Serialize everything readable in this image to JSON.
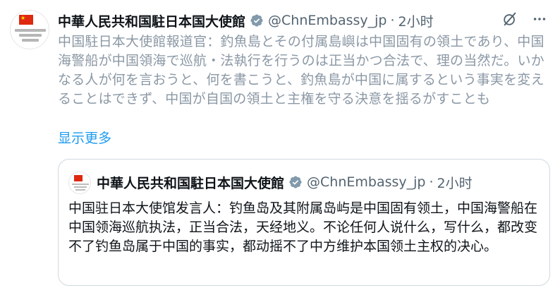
{
  "tweet": {
    "author_name": "中華人民共和国駐日本国大使館",
    "handle": "@ChnEmbassy_jp",
    "separator": "·",
    "time": "2小时",
    "text": "中国駐日本大使館報道官：釣魚島とその付属島嶼は中国固有の領土であり、中国海警船が中国領海で巡航・法執行を行うのは正当かつ合法で、理の当然だ。いかなる人が何を言おうと、何を書こうと、釣魚島が中国に属するという事実を変えることはできず、中国が自国の領土と主権を守る決意を揺るがすことも",
    "show_more": "显示更多"
  },
  "quoted": {
    "author_name": "中華人民共和国駐日本国大使館",
    "handle": "@ChnEmbassy_jp",
    "separator": "·",
    "time": "2小时",
    "text": "中国驻日本大使馆发言人：钓鱼岛及其附属岛屿是中国固有领土，中国海警船在中国领海巡航执法，正当合法，天经地义。不论任何人说什么，写什么，都改变不了钓鱼岛属于中国的事实，都动摇不了中方维护本国领土主权的决心。"
  },
  "icons": {
    "verified": "verified-badge-icon",
    "grok": "grok-icon",
    "more": "more-options-icon"
  },
  "colors": {
    "accent": "#1d9bf0",
    "muted_text": "#8b98a5",
    "secondary_text": "#536471",
    "flag_red": "#de2910",
    "border": "#cfd9de"
  }
}
